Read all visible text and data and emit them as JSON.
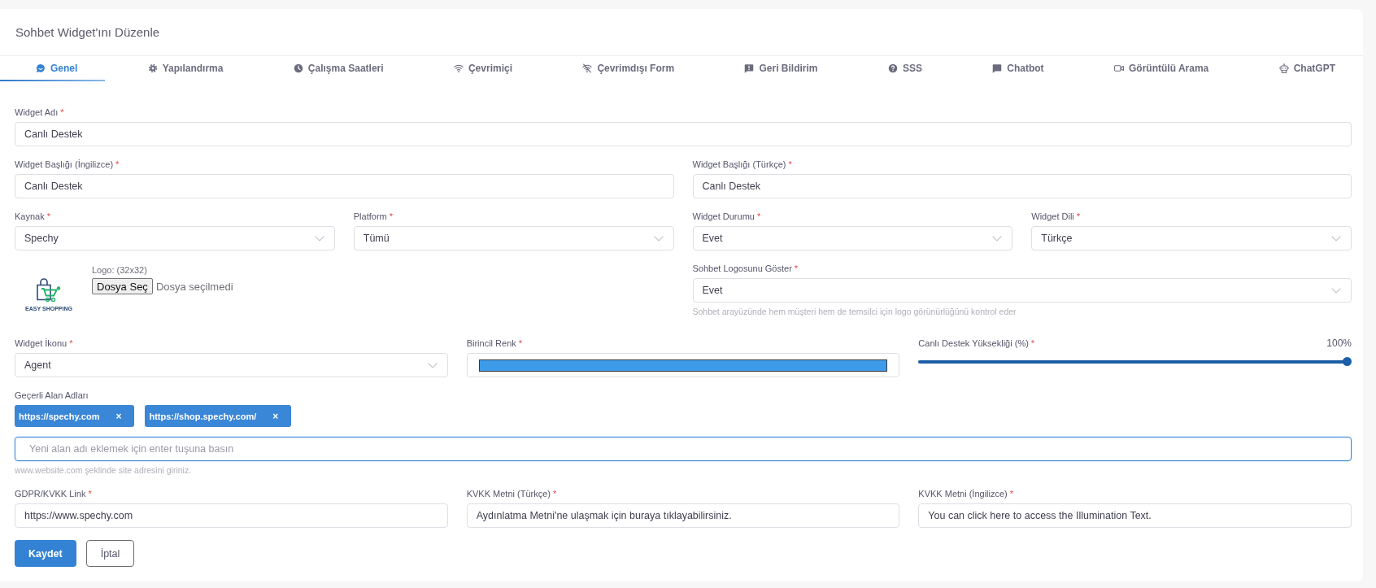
{
  "header": {
    "title": "Sohbet Widget'ını Düzenle"
  },
  "tabs": [
    {
      "label": "Genel",
      "selected": true
    },
    {
      "label": "Yapılandırma",
      "selected": false
    },
    {
      "label": "Çalışma Saatleri",
      "selected": false
    },
    {
      "label": "Çevrimiçi",
      "selected": false
    },
    {
      "label": "Çevrimdışı Form",
      "selected": false
    },
    {
      "label": "Geri Bildirim",
      "selected": false
    },
    {
      "label": "SSS",
      "selected": false
    },
    {
      "label": "Chatbot",
      "selected": false
    },
    {
      "label": "Görüntülü Arama",
      "selected": false
    },
    {
      "label": "ChatGPT",
      "selected": false
    }
  ],
  "form": {
    "rows": [
      [
        {
          "kind": "text",
          "label": "Widget Adı",
          "required_mark": "*",
          "value": "Canlı Destek"
        }
      ],
      [
        {
          "kind": "text",
          "label": "Widget Başlığı (İngilizce)",
          "required_mark": "*",
          "value": "Canlı Destek"
        },
        {
          "kind": "text",
          "label": "Widget Başlığı (Türkçe)",
          "required_mark": "*",
          "value": "Canlı Destek"
        }
      ],
      [
        {
          "kind": "select",
          "label": "Kaynak",
          "required_mark": "*",
          "value": "Spechy"
        },
        {
          "kind": "select",
          "label": "Platform",
          "required_mark": "*",
          "value": "Tümü"
        },
        {
          "kind": "select",
          "label": "Widget Durumu",
          "required_mark": "*",
          "value": "Evet"
        },
        {
          "kind": "select",
          "label": "Widget Dili",
          "required_mark": "*",
          "value": "Türkçe"
        }
      ],
      [
        {
          "kind": "file",
          "logo_text": "EASY SHOPPING",
          "label": "Logo: (32x32)",
          "button": "Dosya Seç",
          "status": "Dosya seçilmedi"
        },
        {
          "kind": "select",
          "label": "Sohbet Logosunu Göster",
          "required_mark": "*",
          "value": "Evet",
          "help": "Sohbet arayüzünde hem müşteri hem de temsilci için logo görünürlüğünü kontrol eder"
        }
      ],
      [
        {
          "kind": "select",
          "label": "Widget İkonu",
          "required_mark": "*",
          "value": "Agent"
        },
        {
          "kind": "color",
          "label": "Birincil Renk",
          "required_mark": "*",
          "color": "#3d9be9"
        },
        {
          "kind": "slider",
          "label": "Canlı Destek Yüksekliği (%)",
          "required_mark": "*",
          "reading": "100%",
          "level": 1
        }
      ],
      [
        {
          "kind": "tags",
          "label": "Geçerli Alan Adları",
          "tags": [
            {
              "text": "https://spechy.com",
              "remove": "×"
            },
            {
              "text": "https://shop.spechy.com/",
              "remove": "×"
            }
          ],
          "placeholder": "Yeni alan adı eklemek için enter tuşuna basın",
          "focused": true,
          "help": "www.website.com şeklinde site adresini giriniz."
        }
      ],
      [
        {
          "kind": "text",
          "label": "GDPR/KVKK Link",
          "required_mark": "*",
          "value": "https://www.spechy.com"
        },
        {
          "kind": "text",
          "label": "KVKK Metni (Türkçe)",
          "required_mark": "*",
          "value": "Aydınlatma Metni'ne ulaşmak için buraya tıklayabilirsiniz."
        },
        {
          "kind": "text",
          "label": "KVKK Metni (İngilizce)",
          "required_mark": "*",
          "value": "You can click here to access the Illumination Text."
        }
      ]
    ]
  },
  "buttons": [
    {
      "kind": "primary",
      "label": "Kaydet"
    },
    {
      "kind": "secondary",
      "label": "İptal"
    }
  ]
}
